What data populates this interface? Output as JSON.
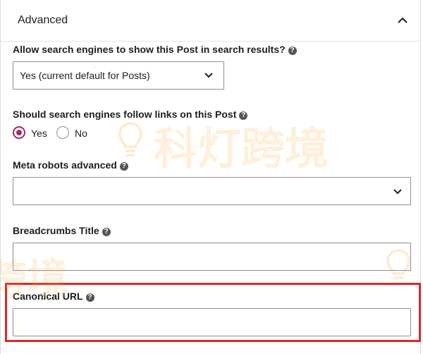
{
  "panel": {
    "title": "Advanced"
  },
  "fields": {
    "search_results": {
      "label": "Allow search engines to show this Post in search results?",
      "selected": "Yes (current default for Posts)"
    },
    "follow_links": {
      "label": "Should search engines follow links on this Post",
      "options": [
        "Yes",
        "No"
      ],
      "selected": "Yes"
    },
    "meta_robots": {
      "label": "Meta robots advanced",
      "selected": ""
    },
    "breadcrumbs_title": {
      "label": "Breadcrumbs Title",
      "value": ""
    },
    "canonical_url": {
      "label": "Canonical URL",
      "value": ""
    }
  },
  "help_glyph": "?",
  "watermark": {
    "main": "科灯跨境",
    "partial": "跨境"
  },
  "colors": {
    "accent": "#a4286a",
    "highlight": "#e0262a",
    "border": "#8c8f94",
    "watermark": "#f7aa3c"
  },
  "icons": {
    "collapse": "chevron-up-icon",
    "dropdown": "chevron-down-icon",
    "help": "help-icon"
  }
}
